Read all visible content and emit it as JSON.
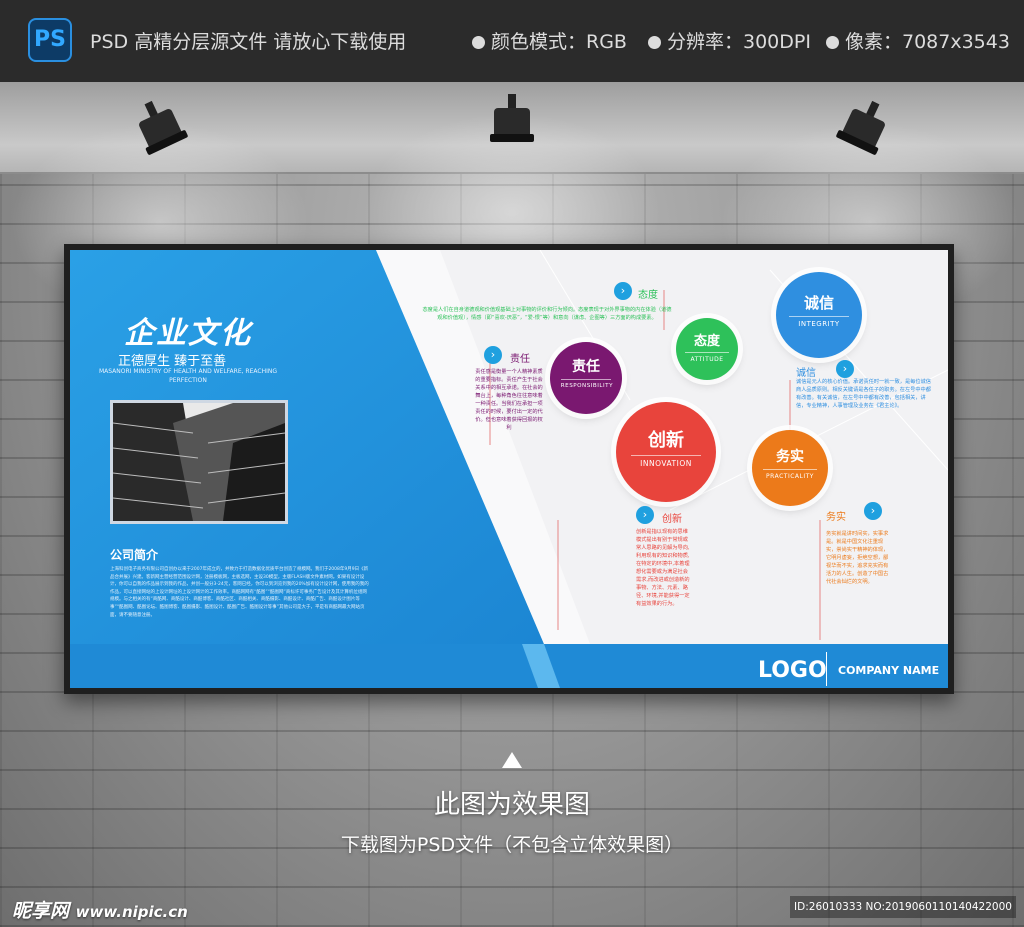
{
  "topbar": {
    "app_icon": "PS",
    "title": "PSD 高精分层源文件 请放心下载使用",
    "specs": [
      {
        "label": "颜色模式：RGB"
      },
      {
        "label": "分辨率：300DPI"
      },
      {
        "label": "像素：7087x3543"
      }
    ]
  },
  "board": {
    "title": "企业文化",
    "subtitle": "正德厚生 臻于至善",
    "subtitle_en": "MASANORI MINISTRY OF HEALTH AND WELFARE, REACHING PERFECTION",
    "intro_title": "公司简介",
    "intro_body": "上海科创电子商务有限公司自创办以来于2007年成立的，并致力于打造数据化优质平台创造了规模网。我们于2008年9月9日《新品合并展》兴建。客新网主营经营范围设计网，注册模板网，主板选网，主设30模型，主版FLASH版文件素材网。如果有设计设计，你可以自我的作品展示到我的作品，并创一般分3-24元，客网已经，你可以到浏览到我的20%加有设计设计网，使用我的我的作品，可以直接网站的上设计网址的上设计网计的工作效率。商酷网网有“酷图”“酷图网”商标许可事务广告设计及其计算机位组网规模。与之相关的有“商酷网、商酷设计、商酷博客、商酷社区、商酷相关、商酷摄影、商酷设计、商酷广告、商酷设计图片等事”“酷图网、酷图论坛、酷图博客、酷图摄影、酷图设计、酷图广告、酷图设计等事”其他公司是大于，平是有商酷网最大网站页面，请不要随意注册。",
    "values": [
      {
        "zh": "责任",
        "en": "RESPONSIBILITY",
        "color": "#7a1870"
      },
      {
        "zh": "态度",
        "en": "ATTITUDE",
        "color": "#2ec15a"
      },
      {
        "zh": "诚信",
        "en": "INTEGRITY",
        "color": "#2f8fe0"
      },
      {
        "zh": "创新",
        "en": "INNOVATION",
        "color": "#e8443c"
      },
      {
        "zh": "务实",
        "en": "PRACTICALITY",
        "color": "#ec7a1a"
      }
    ],
    "tags": {
      "attitude": "态度",
      "responsibility": "责任",
      "integrity": "诚信",
      "innovation": "创新",
      "practicality": "务实"
    },
    "paras": {
      "attitude": "态度是人们在自身道德观和价值观基础上对事物的评价和行为倾向。态度表现于对外界事物的内在体验（道德观和价值观），情感（即“喜欢-厌恶”，“爱-恨”等）和意向（谋虑、企图等）三方面的构成要素。",
      "responsibility": "责任感是衡量一个人精神素质的重要指标。责任产生于社会关系中的相互承诺。在社会的舞台上，每种角色往往意味着一种责任。当我们在承担一项责任的时候，要付出一定的代价。但也意味着获得回报的权利",
      "integrity": "诚信是元人的核心价值。承诺责任时一就一致，是每位诚信商人品质原则。相反关键请是各任子的职务。在左号中中都有改善。有关诚信，在左号中中都有改善，包括相关，讲信，专业精神，人事管理及业务在《君主论》。",
      "innovation": "创新是指以现有的思维模式提出有别于常规或常人思路的见解为导向,利用现有的知识和物质,在特定的环境中,本着理想化需要或为满足社会需求,而改进或创造新的事物、方法、元素、路径、环境,并能获得一定有益效果的行为。",
      "practicality": "务实就是讲时间实，实事求是。就是中国文化注重现实，崇尚实干精神的体现，它明月虚妄，拒绝空想，鄙视华而不实，追求充实而有活力的人生。创造了中国古代社会灿烂的文明。"
    },
    "logo": "LOGO",
    "company": "COMPANY NAME"
  },
  "captions": {
    "main": "此图为效果图",
    "sub": "下载图为PSD文件（不包含立体效果图）"
  },
  "watermark": {
    "brand": "昵享网",
    "url": "www.nipic.cn",
    "id": "ID:26010333 NO:20190601101404220​00"
  }
}
